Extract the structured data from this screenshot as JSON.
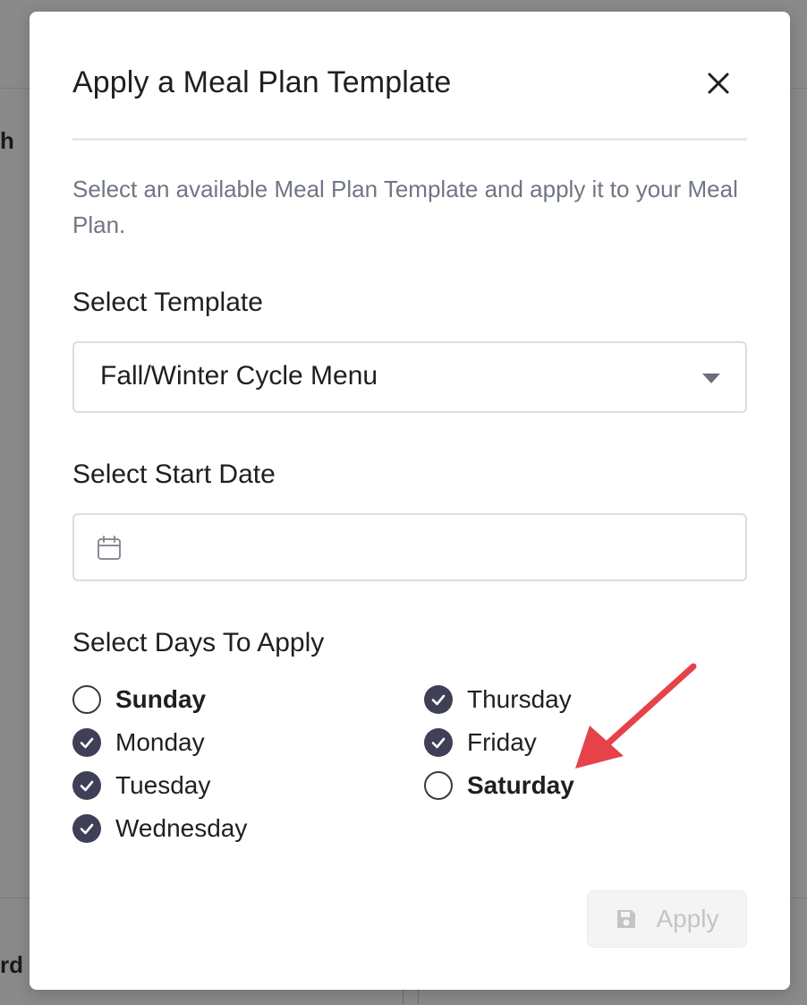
{
  "background": {
    "fragment_top": "h",
    "fragment_bottom": "rd"
  },
  "modal": {
    "title": "Apply a Meal Plan Template",
    "close_icon": "close-icon",
    "description": "Select an available Meal Plan Template and apply it to your Meal Plan."
  },
  "template": {
    "label": "Select Template",
    "selected": "Fall/Winter Cycle Menu"
  },
  "start_date": {
    "label": "Select Start Date",
    "value": "",
    "icon": "calendar-icon"
  },
  "days": {
    "label": "Select Days To Apply",
    "items": [
      {
        "label": "Sunday",
        "checked": false
      },
      {
        "label": "Monday",
        "checked": true
      },
      {
        "label": "Tuesday",
        "checked": true
      },
      {
        "label": "Wednesday",
        "checked": true
      },
      {
        "label": "Thursday",
        "checked": true
      },
      {
        "label": "Friday",
        "checked": true
      },
      {
        "label": "Saturday",
        "checked": false
      }
    ]
  },
  "apply_button": {
    "label": "Apply",
    "icon": "save-icon",
    "disabled": true
  },
  "colors": {
    "checkbox_checked": "#3f4057",
    "annotation_arrow": "#e5424a",
    "description_text": "#707683"
  }
}
